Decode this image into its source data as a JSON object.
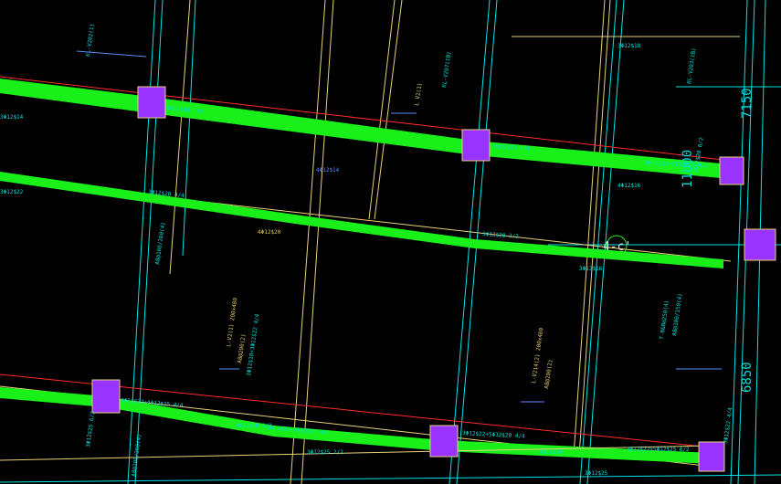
{
  "colors": {
    "background": "#000000",
    "axis_line": "#00e5e5",
    "beam_edge": "#e8d27a",
    "beam_fill": "#19f019",
    "beam_red": "#ff2a2a",
    "column": "#9933ff",
    "text_cyan": "#00dddd",
    "text_blue": "#5b8cff",
    "text_yellow": "#e0c860",
    "dim_text": "#00dddd",
    "marker": "#19f019"
  },
  "drawing": {
    "dimension_top": "7150",
    "dimension_mid": "11000",
    "dimension_bottom": "6850",
    "axis_marker": "4-c'",
    "labels": [
      "3Φ12$18 4/4",
      "3Φ12$20 4/4",
      "3Φ12$20 6/2",
      "3Φ12$22 4/4",
      "3Φ12$20 2/2",
      "3Φ12$22",
      "3Φ12$14",
      "4Φ12$14",
      "4Φ12$16",
      "3Φ12$16",
      "4Φ12$20",
      "3Φ12$18",
      "3Φ12$22+4Φ12$25 4/4",
      "3Φ12$22+5Φ12$20 4/4",
      "3Φ12$22+5Φ12$25 4/2",
      "3Φ12$22+5Φ12$25 6/2",
      "3Φ12$22+4Φ12$25 4/4",
      "3Φ12$18+3Φ12$22 4/4",
      "3Φ12$25 2/2",
      "3Φ12$20 2/2",
      "3Φ12$25",
      "3Φ12$18",
      "L-V2(1) 200x400",
      "A8@200(2)",
      "L-V214(2) 200x400",
      "A8@200(2)",
      "KL-V207(1B)",
      "KL-V202(1)",
      "L V2(1)",
      "KL-V203(1B)",
      "A8@100/200(4)",
      "A8@100/200(4)",
      "A8@100/150(4)",
      "T-B&B@250(4)",
      "3Φ12$25 6/2",
      "3Φ12$22 4/4"
    ]
  }
}
